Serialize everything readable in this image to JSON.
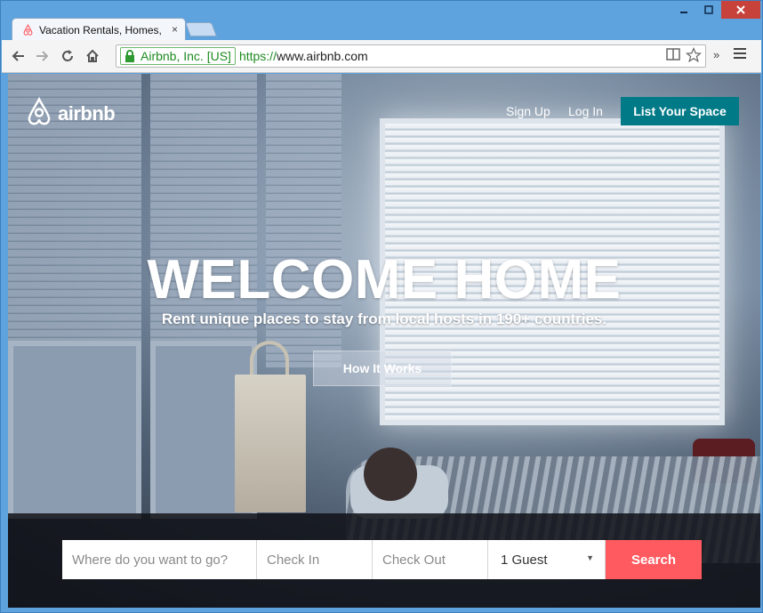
{
  "browser": {
    "tab_title": "Vacation Rentals, Homes,",
    "tab_close": "×",
    "ev_name": "Airbnb, Inc. [US]",
    "url_scheme": "https://",
    "url_host": "www.airbnb.com",
    "ext_chevron": "»"
  },
  "header": {
    "logo_text": "airbnb",
    "sign_up": "Sign Up",
    "log_in": "Log In",
    "list_space": "List Your Space"
  },
  "hero": {
    "title": "WELCOME HOME",
    "subtitle": "Rent unique places to stay from local hosts in 190+ countries.",
    "how_it_works": "How It Works"
  },
  "search": {
    "where_placeholder": "Where do you want to go?",
    "check_in_placeholder": "Check In",
    "check_out_placeholder": "Check Out",
    "guests_value": "1 Guest",
    "search_label": "Search"
  },
  "colors": {
    "brand_red": "#ff5a5f",
    "teal": "#007a87"
  }
}
